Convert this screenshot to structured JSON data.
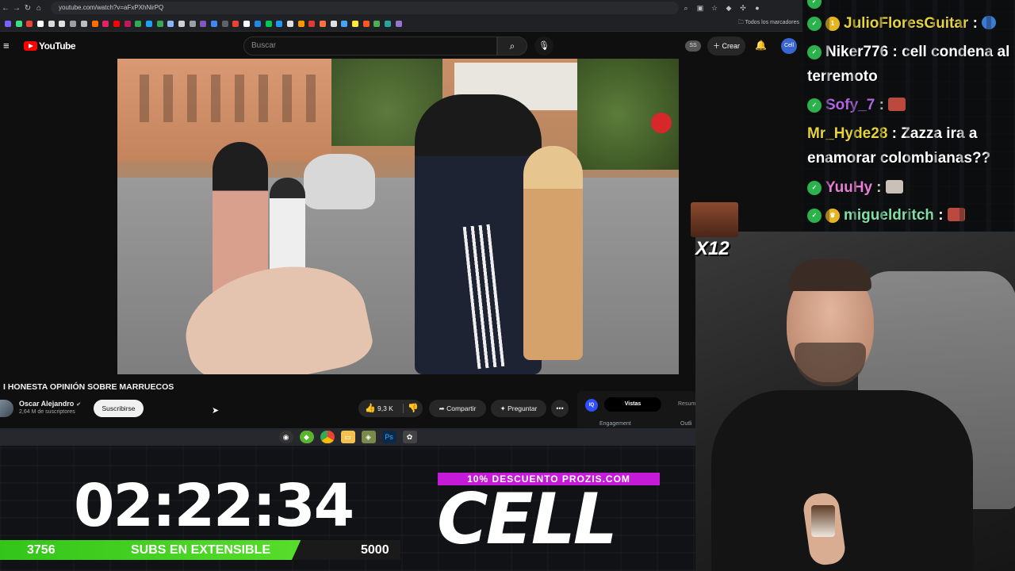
{
  "browser": {
    "url": "youtube.com/watch?v=aFxPXhNirPQ",
    "bookmarks_folder": "Todos los marcadores",
    "bookmark_colors": [
      "#7b61ff",
      "#3ddc84",
      "#ea4335",
      "#ffffff",
      "#d9d9d9",
      "#e0e0e0",
      "#9aa0a6",
      "#bdbdbd",
      "#ff6d00",
      "#e91e63",
      "#ff0000",
      "#c2185b",
      "#34a853",
      "#1da1f2",
      "#34a853",
      "#8ab4f8",
      "#d0d0d0",
      "#9aa0a6",
      "#7e57c2",
      "#4285f4",
      "#5f6368",
      "#ea4335",
      "#ffffff",
      "#1e88e5",
      "#00c853",
      "#2196f3",
      "#e0e0e0",
      "#ff9800",
      "#e53935",
      "#ff7043",
      "#e0e0e0",
      "#42a5f5",
      "#ffeb3b",
      "#ff5722",
      "#4caf50",
      "#26a69a",
      "#9575cd"
    ]
  },
  "youtube": {
    "logo_text": "YouTube",
    "search_placeholder": "Buscar",
    "ss_badge": "SS",
    "create_label": "Crear",
    "avatar_text": "Cell"
  },
  "video": {
    "title": "I HONESTA OPINIÓN SOBRE MARRUECOS",
    "channel": "Oscar Alejandro",
    "subscribers": "2,64 M de suscriptores",
    "subscribe_label": "Suscribirse",
    "like_count": "9,3 K",
    "share_label": "Compartir",
    "ask_label": "Preguntar"
  },
  "extension": {
    "logo": "IQ",
    "tab_views": "Vistas",
    "tab_summary": "Resum",
    "engagement": "Engagement",
    "outline": "Outli"
  },
  "overlay": {
    "timer": "02:22:34",
    "subs_current": "3756",
    "subs_goal": "5000",
    "subs_progress": 0.7512,
    "subs_label": "SUBS EN EXTENSIBLE",
    "promo": "10% DESCUENTO PROZIS.COM",
    "brand": "CELL",
    "emote_multiplier": "X12"
  },
  "chat": [
    {
      "user": "JulioFloresGuitar",
      "color": "#e6d33b",
      "text": "",
      "emote": "earth-emote"
    },
    {
      "user": "Niker776",
      "color": "#ffffff",
      "text": "cell condena al terremoto",
      "emote": ""
    },
    {
      "user": "Sofy_7",
      "color": "#b066e0",
      "text": "",
      "emote": "face-emote"
    },
    {
      "user": "Mr_Hyde28",
      "color": "#e6d33b",
      "text": "Zazza ira a enamorar colombianas??",
      "emote": ""
    },
    {
      "user": "YuuHy",
      "color": "#e87dd6",
      "text": "",
      "emote": "face-emote"
    },
    {
      "user": "migueldritch",
      "color": "#7fe0a6",
      "text": "",
      "emote": "face-emote"
    }
  ]
}
